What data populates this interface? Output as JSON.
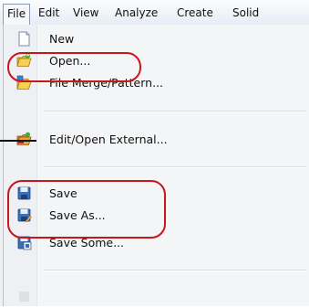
{
  "menubar": {
    "items": [
      "File",
      "Edit",
      "View",
      "Analyze",
      "Create",
      "Solid"
    ]
  },
  "menu": {
    "items": [
      {
        "label": "New",
        "icon": "new-file-icon"
      },
      {
        "label": "Open...",
        "icon": "open-folder-icon"
      },
      {
        "label": "File Merge/Pattern...",
        "icon": "file-merge-icon"
      },
      {
        "label": "Edit/Open External...",
        "icon": "edit-open-external-icon"
      },
      {
        "label": "Save",
        "icon": "save-icon"
      },
      {
        "label": "Save As...",
        "icon": "save-as-icon"
      },
      {
        "label": "Save Some...",
        "icon": "save-some-icon"
      }
    ]
  },
  "colors": {
    "callout": "#c8161d",
    "menubar_bg": "#e6ecf5",
    "dropdown_bg": "#f4f5f7"
  }
}
